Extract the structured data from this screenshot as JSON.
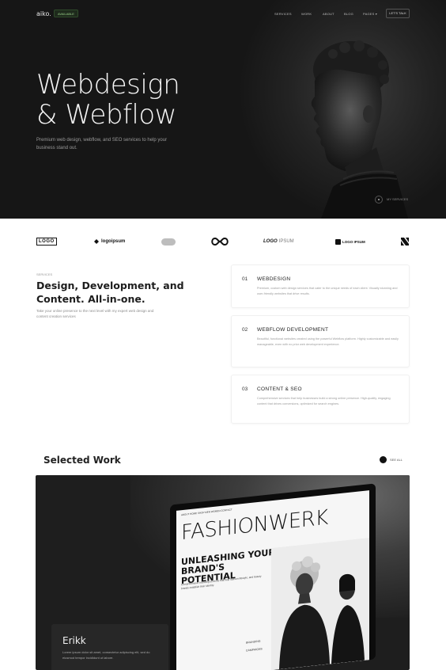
{
  "nav": {
    "logo": "aiko.",
    "badge": "AVAILABLE",
    "links": [
      "SERVICES",
      "WORK",
      "ABOUT",
      "BLOG",
      "PAGES ▾"
    ],
    "cta": "LET'S TALK"
  },
  "hero": {
    "title": "Webdesign\n& Webflow",
    "subtitle": "Premium web design, webflow, and SEO services to help your business stand out.",
    "scroll_label": "MY SERVICES"
  },
  "logos": [
    "LOGO",
    "logoipsum",
    "LOGO",
    "LOGO IPSUM",
    "LOGOIPSUM"
  ],
  "services": {
    "kicker": "SERVICES",
    "title": "Design, Development, and Content. All-in-one.",
    "description": "Take your online presence to the next level with my expert web design and content creation services",
    "items": [
      {
        "num": "01",
        "name": "WEBDESIGN",
        "text": "Premium, custom web design services that cater to the unique needs of each client. Visually stunning and user-friendly websites that drive results."
      },
      {
        "num": "02",
        "name": "WEBFLOW DEVELOPMENT",
        "text": "Beautiful, functional websites created using the powerful Webflow platform. Highly customizable and easily manageable, even with no prior web development experience."
      },
      {
        "num": "03",
        "name": "CONTENT & SEO",
        "text": "Comprehensive services that help businesses build a strong online presence. High-quality, engaging content that drives conversions, optimized for search engines."
      }
    ]
  },
  "work": {
    "title": "Selected Work",
    "see_all": "SEE ALL",
    "project_name": "Erikk",
    "project_desc": "Lorem ipsum dolor sit amet, consectetur adipiscing elit, sed do eiusmod tempor incididunt ut labore.",
    "screen": {
      "nav": "ABOUT   HOME   SHOP   MEN   WOMEN   CONTACT",
      "brand": "FASHIONWERK",
      "tagline": "UNLEASHING YOUR BRAND'S POTENTIAL",
      "small": "Comprehensive branding services that help fashion lifestyle, and beauty brands establish their identity.",
      "cat1": "BRANDING",
      "cat2": "CAMPAIGNS"
    }
  }
}
